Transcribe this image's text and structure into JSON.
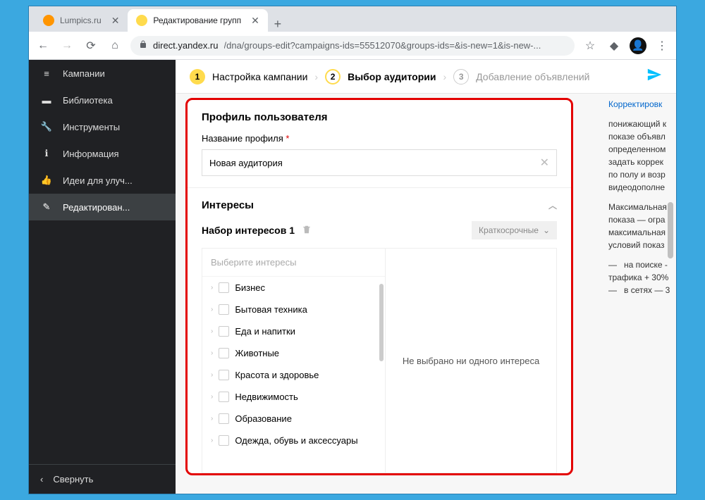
{
  "tabs": [
    {
      "label": "Lumpics.ru",
      "active": false,
      "iconColor": "#ff9500"
    },
    {
      "label": "Редактирование групп",
      "active": true,
      "iconColor": "#ffdb4d"
    }
  ],
  "url": {
    "domain": "direct.yandex.ru",
    "path": "/dna/groups-edit?campaigns-ids=55512070&groups-ids=&is-new=1&is-new-..."
  },
  "sidebar": {
    "items": [
      {
        "label": "Кампании",
        "icon": "menu"
      },
      {
        "label": "Библиотека",
        "icon": "book"
      },
      {
        "label": "Инструменты",
        "icon": "wrench"
      },
      {
        "label": "Информация",
        "icon": "info"
      },
      {
        "label": "Идеи для улуч...",
        "icon": "thumb"
      },
      {
        "label": "Редактирован...",
        "icon": "pencil",
        "active": true
      }
    ],
    "collapse": "Свернуть"
  },
  "steps": [
    {
      "num": "1",
      "label": "Настройка кампании",
      "state": "done"
    },
    {
      "num": "2",
      "label": "Выбор аудитории",
      "state": "current"
    },
    {
      "num": "3",
      "label": "Добавление объявлений",
      "state": "todo"
    }
  ],
  "profile": {
    "heading": "Профиль пользователя",
    "nameLabel": "Название профиля",
    "nameValue": "Новая аудитория"
  },
  "interests": {
    "heading": "Интересы",
    "setLabel": "Набор интересов 1",
    "typeLabel": "Краткосрочные",
    "searchPlaceholder": "Выберите интересы",
    "empty": "Не выбрано ни одного интереса",
    "categories": [
      "Бизнес",
      "Бытовая техника",
      "Еда и напитки",
      "Животные",
      "Красота и здоровье",
      "Недвижимость",
      "Образование",
      "Одежда, обувь и аксессуары"
    ]
  },
  "help": {
    "link": "Корректировк",
    "p1": "понижающий к\nпоказе объявл\nопределенном\nзадать коррек\nпо полу и возр\nвидеодополне",
    "p2": "Максимальная\nпоказа — огра\nмаксимальная\nусловий показ",
    "p3": "—   на поиске -\nтрафика + 30%\n—   в сетях — 3"
  }
}
